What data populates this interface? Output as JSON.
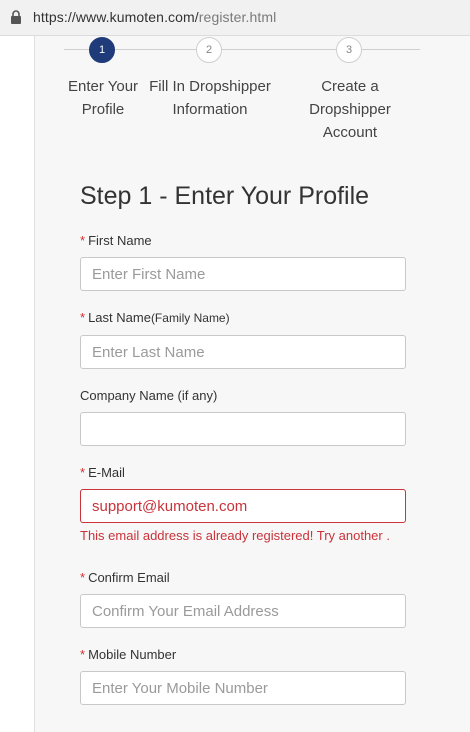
{
  "browser": {
    "url_host": "https://www.kumoten.com/",
    "url_path": "register.html"
  },
  "stepper": {
    "steps": [
      {
        "number": "1",
        "line1": "Enter Your",
        "line2": "Profile",
        "line3": ""
      },
      {
        "number": "2",
        "line1": "Fill In Dropshipper",
        "line2": "Information",
        "line3": ""
      },
      {
        "number": "3",
        "line1": "Create a",
        "line2": "Dropshipper",
        "line3": "Account"
      }
    ],
    "active_step": 1
  },
  "form": {
    "title": "Step 1 - Enter Your Profile",
    "required_mark": "*",
    "first_name": {
      "label": "First Name",
      "placeholder": "Enter First Name",
      "value": ""
    },
    "last_name": {
      "label_main": "Last Name",
      "label_sub": "(Family Name)",
      "placeholder": "Enter Last Name",
      "value": ""
    },
    "company": {
      "label": "Company Name (if any)",
      "placeholder": "",
      "value": ""
    },
    "email": {
      "label": "E-Mail",
      "value": "support@kumoten.com",
      "error": "This email address is already registered! Try another ."
    },
    "confirm_email": {
      "label": "Confirm Email",
      "placeholder": "Confirm Your Email Address",
      "value": ""
    },
    "mobile": {
      "label": "Mobile Number",
      "placeholder": "Enter Your Mobile Number",
      "value": ""
    }
  },
  "colors": {
    "accent": "#1f3b7a",
    "required": "#d0312d",
    "error": "#c9333a"
  }
}
